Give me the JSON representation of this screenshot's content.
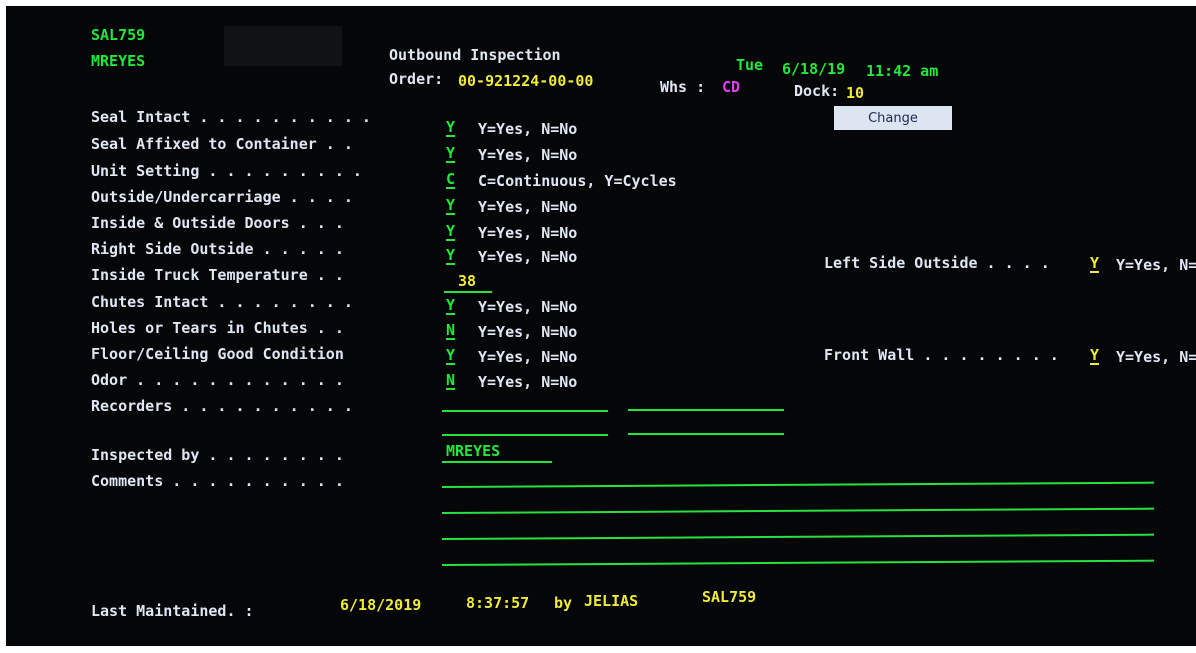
{
  "header": {
    "program": "SAL759",
    "user": "MREYES",
    "title": "Outbound Inspection",
    "order_label": "Order:",
    "order_value": "00-921224-00-00",
    "whs_label": "Whs :",
    "whs_value": "CD",
    "day": "Tue",
    "date": "6/18/19",
    "time": "11:42 am",
    "dock_label": "Dock:",
    "dock_value": "10",
    "change_button": "Change"
  },
  "fields": [
    {
      "label": "Seal Intact . . . . . . . . . .",
      "value": "Y",
      "hint": "Y=Yes, N=No"
    },
    {
      "label": "Seal Affixed to Container . .",
      "value": "Y",
      "hint": "Y=Yes, N=No"
    },
    {
      "label": "Unit Setting . . . . . . . . .",
      "value": "C",
      "hint": "C=Continuous, Y=Cycles"
    },
    {
      "label": "Outside/Undercarriage . . . .",
      "value": "Y",
      "hint": "Y=Yes, N=No"
    },
    {
      "label": "Inside & Outside Doors . . .",
      "value": "Y",
      "hint": "Y=Yes, N=No"
    },
    {
      "label": "Right Side Outside . . . . .",
      "value": "Y",
      "hint": "Y=Yes, N=No"
    },
    {
      "label": "Inside Truck Temperature . .",
      "value": "38",
      "hint": ""
    },
    {
      "label": "Chutes Intact . . . . . . . .",
      "value": "Y",
      "hint": "Y=Yes, N=No"
    },
    {
      "label": "Holes or Tears in Chutes . .",
      "value": "N",
      "hint": "Y=Yes, N=No"
    },
    {
      "label": "Floor/Ceiling Good Condition",
      "value": "Y",
      "hint": "Y=Yes, N=No"
    },
    {
      "label": "Odor . . . . . . . . . . . .",
      "value": "N",
      "hint": "Y=Yes, N=No"
    },
    {
      "label": "Recorders . . . . . . . . . .",
      "value": "",
      "hint": ""
    }
  ],
  "right_fields": [
    {
      "label": "Left Side Outside . . . .",
      "value": "Y",
      "hint": "Y=Yes, N="
    },
    {
      "label": "Front Wall . . . . . . . .",
      "value": "Y",
      "hint": "Y=Yes, N="
    }
  ],
  "inspected_by": {
    "label": "Inspected by . . . . . . . .",
    "value": "MREYES"
  },
  "comments": {
    "label": "Comments . . . . . . . . . ."
  },
  "footer": {
    "label": "Last Maintained. :",
    "date": "6/18/2019",
    "time": "8:37:57",
    "by": "by",
    "user": "JELIAS",
    "program": "SAL759"
  },
  "colors": {
    "screen_bg": "#050608",
    "green": "#22e83a",
    "white": "#dfe6f4",
    "yellow": "#f0ea38",
    "magenta": "#e23cf0"
  }
}
